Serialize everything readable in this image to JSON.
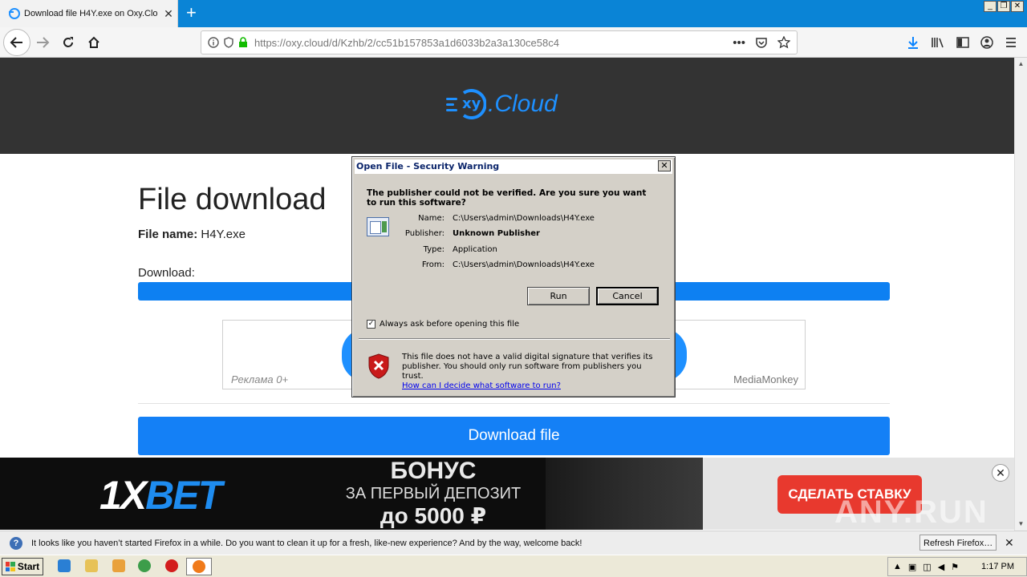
{
  "browser": {
    "tab_title": "Download file H4Y.exe on Oxy.Clo",
    "tab_close": "✕",
    "new_tab": "+",
    "url_host": "https://oxy.cloud",
    "url_path": "/d/Kzhb/2/cc51b157853a1d6033b2a3a130ce58c4",
    "url_more": "•••"
  },
  "window_controls": {
    "minimize": "_",
    "restore": "❐",
    "close": "✕"
  },
  "page": {
    "logo_text_xy": "xy",
    "logo_text_cloud": ".Cloud",
    "title": "File download",
    "file_name_label": "File name:",
    "file_name_value": "H4Y.exe",
    "download_label": "Download:",
    "download_progress": 1.0,
    "ad_left_label": "Реклама 0+",
    "ad_right_label": "MediaMonkey",
    "download_button": "Download file"
  },
  "banner": {
    "brand_1x": "1X",
    "brand_bet": "BET",
    "line1": "БОНУС",
    "line2": "ЗА ПЕРВЫЙ ДЕПОЗИТ",
    "line3": "до 5000 ₽",
    "cta": "СДЕЛАТЬ СТАВКУ",
    "close": "✕",
    "watermark": "ANY.RUN"
  },
  "dialog": {
    "title": "Open File - Security Warning",
    "close": "✕",
    "question": "The publisher could not be verified.  Are you sure you want to run this software?",
    "fields": [
      {
        "label": "Name:",
        "value": "C:\\Users\\admin\\Downloads\\H4Y.exe",
        "bold": false
      },
      {
        "label": "Publisher:",
        "value": "Unknown Publisher",
        "bold": true
      },
      {
        "label": "Type:",
        "value": "Application",
        "bold": false
      },
      {
        "label": "From:",
        "value": "C:\\Users\\admin\\Downloads\\H4Y.exe",
        "bold": false
      }
    ],
    "run_button": "Run",
    "cancel_button": "Cancel",
    "checkbox_label": "Always ask before opening this file",
    "checkbox_checked": true,
    "warning_text": "This file does not have a valid digital signature that verifies its publisher.  You should only run software from publishers you trust.",
    "warning_link": "How can I decide what software to run?"
  },
  "notification": {
    "text": "It looks like you haven’t started Firefox in a while. Do you want to clean it up for a fresh, like-new experience? And by the way, welcome back!",
    "button": "Refresh Firefox…",
    "close": "✕"
  },
  "taskbar": {
    "start": "Start",
    "clock": "1:17 PM"
  },
  "colors": {
    "accent_blue": "#1480f6",
    "hero_bg": "#333333",
    "cta_red": "#e8392e",
    "dialog_bg": "#d4d0c8"
  }
}
